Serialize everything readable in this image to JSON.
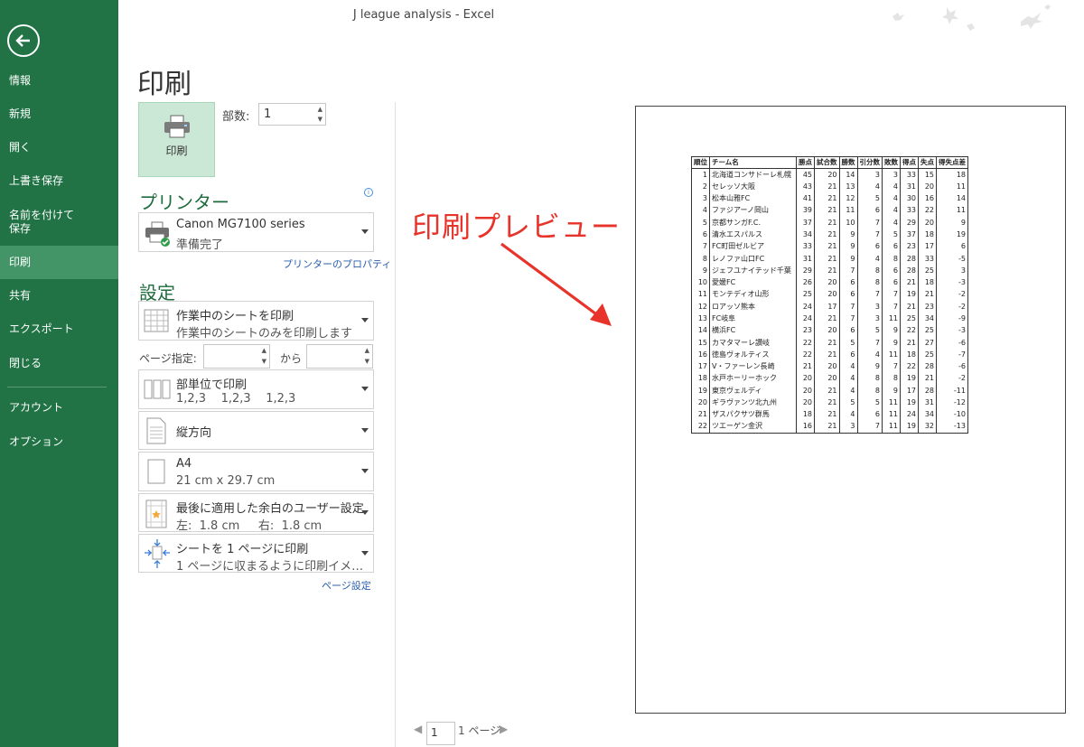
{
  "window": {
    "title": "J league analysis - Excel"
  },
  "sidebar": {
    "items": [
      {
        "label": "情報"
      },
      {
        "label": "新規"
      },
      {
        "label": "開く"
      },
      {
        "label": "上書き保存"
      },
      {
        "label": "名前を付けて"
      },
      {
        "label": "保存"
      },
      {
        "label": "印刷"
      },
      {
        "label": "共有"
      },
      {
        "label": "エクスポート"
      },
      {
        "label": "閉じる"
      },
      {
        "label": "アカウント"
      },
      {
        "label": "オプション"
      }
    ]
  },
  "print": {
    "title": "印刷",
    "button_label": "印刷",
    "copies_label": "部数:",
    "copies_value": "1"
  },
  "printer": {
    "header": "プリンター",
    "name": "Canon MG7100 series",
    "status": "準備完了",
    "properties_link": "プリンターのプロパティ"
  },
  "settings": {
    "header": "設定",
    "scope_main": "作業中のシートを印刷",
    "scope_sub": "作業中のシートのみを印刷します",
    "pages_label": "ページ指定:",
    "pages_to": "から",
    "collate_main": "部単位で印刷",
    "collate_sub": "1,2,3    1,2,3    1,2,3",
    "orientation": "縦方向",
    "paper_main": "A4",
    "paper_sub": "21 cm x 29.7 cm",
    "margins_main": "最後に適用した余白のユーザー設定",
    "margins_sub": "左:  1.8 cm     右:  1.8 cm",
    "scaling_main": "シートを 1 ページに印刷",
    "scaling_sub": "1 ページに収まるように印刷イメ…",
    "page_setup_link": "ページ設定"
  },
  "annotation": "印刷プレビュー",
  "pager": {
    "current": "1",
    "total": "1 ページ"
  },
  "sheet": {
    "headers": [
      "順位",
      "チーム名",
      "勝点",
      "試合数",
      "勝数",
      "引分数",
      "敗数",
      "得点",
      "失点",
      "得失点差"
    ],
    "rows": [
      [
        "1",
        "北海道コンサドーレ札幌",
        "45",
        "20",
        "14",
        "3",
        "3",
        "33",
        "15",
        "18"
      ],
      [
        "2",
        "セレッソ大阪",
        "43",
        "21",
        "13",
        "4",
        "4",
        "31",
        "20",
        "11"
      ],
      [
        "3",
        "松本山雅FC",
        "41",
        "21",
        "12",
        "5",
        "4",
        "30",
        "16",
        "14"
      ],
      [
        "4",
        "ファジアーノ岡山",
        "39",
        "21",
        "11",
        "6",
        "4",
        "33",
        "22",
        "11"
      ],
      [
        "5",
        "京都サンガF.C.",
        "37",
        "21",
        "10",
        "7",
        "4",
        "29",
        "20",
        "9"
      ],
      [
        "6",
        "清水エスパルス",
        "34",
        "21",
        "9",
        "7",
        "5",
        "37",
        "18",
        "19"
      ],
      [
        "7",
        "FC町田ゼルビア",
        "33",
        "21",
        "9",
        "6",
        "6",
        "23",
        "17",
        "6"
      ],
      [
        "8",
        "レノファ山口FC",
        "31",
        "21",
        "9",
        "4",
        "8",
        "28",
        "33",
        "-5"
      ],
      [
        "9",
        "ジェフユナイテッド千葉",
        "29",
        "21",
        "7",
        "8",
        "6",
        "28",
        "25",
        "3"
      ],
      [
        "10",
        "愛媛FC",
        "26",
        "20",
        "6",
        "8",
        "6",
        "21",
        "18",
        "-3"
      ],
      [
        "11",
        "モンテディオ山形",
        "25",
        "20",
        "6",
        "7",
        "7",
        "19",
        "21",
        "-2"
      ],
      [
        "12",
        "ロアッソ熊本",
        "24",
        "17",
        "7",
        "3",
        "7",
        "21",
        "23",
        "-2"
      ],
      [
        "13",
        "FC岐阜",
        "24",
        "21",
        "7",
        "3",
        "11",
        "25",
        "34",
        "-9"
      ],
      [
        "14",
        "横浜FC",
        "23",
        "20",
        "6",
        "5",
        "9",
        "22",
        "25",
        "-3"
      ],
      [
        "15",
        "カマタマーレ讃岐",
        "22",
        "21",
        "5",
        "7",
        "9",
        "21",
        "27",
        "-6"
      ],
      [
        "16",
        "徳島ヴォルティス",
        "22",
        "21",
        "6",
        "4",
        "11",
        "18",
        "25",
        "-7"
      ],
      [
        "17",
        "V・ファーレン長崎",
        "21",
        "20",
        "4",
        "9",
        "7",
        "22",
        "28",
        "-6"
      ],
      [
        "18",
        "水戸ホーリーホック",
        "20",
        "20",
        "4",
        "8",
        "8",
        "19",
        "21",
        "-2"
      ],
      [
        "19",
        "東京ヴェルディ",
        "20",
        "21",
        "4",
        "8",
        "9",
        "17",
        "28",
        "-11"
      ],
      [
        "20",
        "ギラヴァンツ北九州",
        "20",
        "21",
        "5",
        "5",
        "11",
        "19",
        "31",
        "-12"
      ],
      [
        "21",
        "ザスパクサツ群馬",
        "18",
        "21",
        "4",
        "6",
        "11",
        "24",
        "34",
        "-10"
      ],
      [
        "22",
        "ツエーゲン金沢",
        "16",
        "21",
        "3",
        "7",
        "11",
        "19",
        "32",
        "-13"
      ]
    ]
  }
}
